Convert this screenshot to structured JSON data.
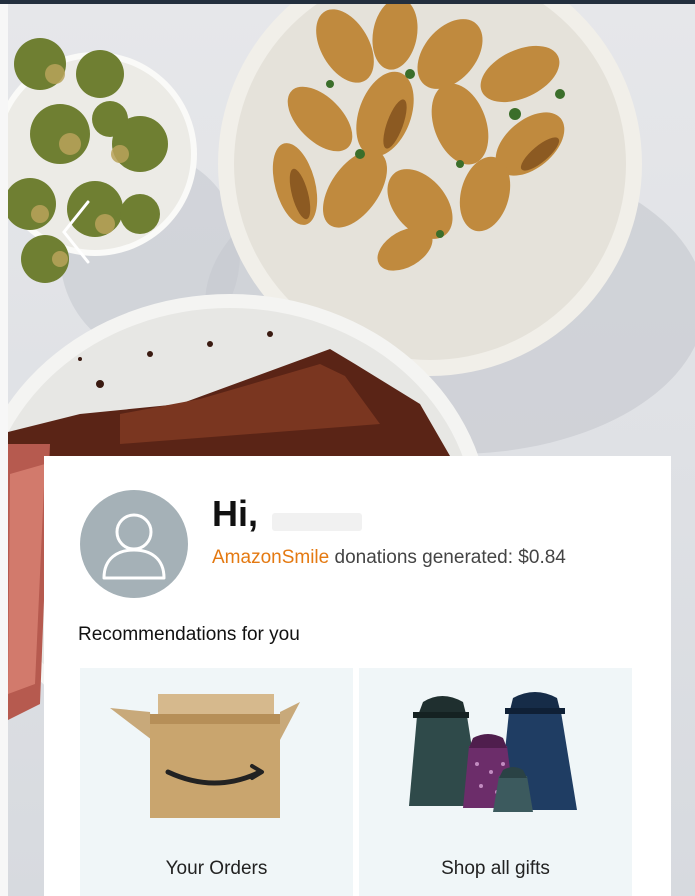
{
  "hero": {
    "nav_prev_icon": "chevron-left-icon"
  },
  "account": {
    "greeting": "Hi,",
    "avatar_icon": "user-avatar-icon",
    "smile_link": "AmazonSmile",
    "donations_text": " donations generated: $0.84"
  },
  "recommendations": {
    "title": "Recommendations for you",
    "tiles": [
      {
        "label": "Your Orders",
        "icon": "amazon-box-icon"
      },
      {
        "label": "Shop all gifts",
        "icon": "gift-bags-icon"
      }
    ]
  },
  "colors": {
    "smile_orange": "#e47911",
    "avatar_gray": "#a5b1b7",
    "tile_bg": "#f0f6f8"
  }
}
